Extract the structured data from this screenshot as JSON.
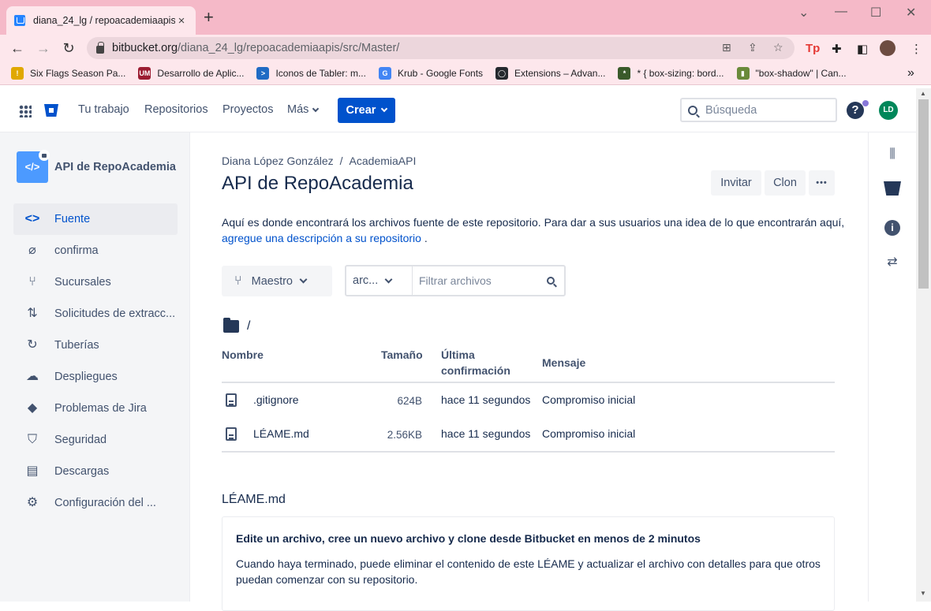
{
  "browser": {
    "tab_title": "diana_24_lg / repoacademiaapis",
    "tab_close": "×",
    "new_tab": "+",
    "url_host": "bitbucket.org",
    "url_path": "/diana_24_lg/repoacademiaapis/src/Master/",
    "bookmarks": [
      {
        "label": "Six Flags Season Pa...",
        "color": "#e0a800",
        "glyph": "!"
      },
      {
        "label": "Desarrollo de Aplic...",
        "color": "#9b1c31",
        "glyph": "UM"
      },
      {
        "label": "Iconos de Tabler: m...",
        "color": "#206bc4",
        "glyph": ">"
      },
      {
        "label": "Krub - Google Fonts",
        "color": "#4285f4",
        "glyph": "G"
      },
      {
        "label": "Extensions – Advan...",
        "color": "#24292e",
        "glyph": "◯"
      },
      {
        "label": "* { box-sizing: bord...",
        "color": "#3a5a2a",
        "glyph": "*"
      },
      {
        "label": "\"box-shadow\" | Can...",
        "color": "#6a8a3a",
        "glyph": "▮"
      }
    ],
    "bookmarks_more": "»"
  },
  "topnav": {
    "links": [
      "Tu trabajo",
      "Repositorios",
      "Proyectos",
      "Más"
    ],
    "create_label": "Crear",
    "search_placeholder": "Búsqueda",
    "help_glyph": "?",
    "avatar_initials": "LD"
  },
  "sidebar": {
    "repo_name": "API de RepoAcademia",
    "repo_avatar_glyph": "</>",
    "items": [
      {
        "label": "Fuente",
        "icon": "code-icon",
        "glyph": "<>",
        "active": true
      },
      {
        "label": "confirma",
        "icon": "commit-icon",
        "glyph": "⌀",
        "active": false
      },
      {
        "label": "Sucursales",
        "icon": "branch-icon",
        "glyph": "⑂",
        "active": false
      },
      {
        "label": "Solicitudes de extracc...",
        "icon": "pull-request-icon",
        "glyph": "⇅",
        "active": false
      },
      {
        "label": "Tuberías",
        "icon": "pipelines-icon",
        "glyph": "↻",
        "active": false
      },
      {
        "label": "Despliegues",
        "icon": "deployments-icon",
        "glyph": "☁",
        "active": false
      },
      {
        "label": "Problemas de Jira",
        "icon": "jira-icon",
        "glyph": "◆",
        "active": false
      },
      {
        "label": "Seguridad",
        "icon": "shield-icon",
        "glyph": "⛉",
        "active": false
      },
      {
        "label": "Descargas",
        "icon": "downloads-icon",
        "glyph": "▤",
        "active": false
      },
      {
        "label": "Configuración del ...",
        "icon": "gear-icon",
        "glyph": "⚙",
        "active": false
      }
    ]
  },
  "main": {
    "breadcrumb_owner": "Diana López González",
    "breadcrumb_sep": "/",
    "breadcrumb_project": "AcademiaAPI",
    "title": "API de RepoAcademia",
    "invite_label": "Invitar",
    "clone_label": "Clon",
    "more_label": "•••",
    "description_text": "Aquí es donde encontrará los archivos fuente de este repositorio. Para dar a sus usuarios una idea de lo que encontrarán aquí,",
    "description_link": "agregue una descripción a su repositorio",
    "description_end": " .",
    "branch_label": "Maestro",
    "filter_type": "arc...",
    "filter_placeholder": "Filtrar archivos",
    "path_root": "/",
    "columns": {
      "name": "Nombre",
      "size": "Tamaño",
      "last_commit_1": "Última",
      "last_commit_2": "confirmación",
      "message": "Mensaje"
    },
    "files": [
      {
        "name": ".gitignore",
        "size": "624B",
        "time": "hace 11 segundos",
        "message": "Compromiso inicial"
      },
      {
        "name": "LÉAME.md",
        "size": "2.56KB",
        "time": "hace 11 segundos",
        "message": "Compromiso inicial"
      }
    ],
    "readme_title": "LÉAME.md",
    "readme_heading": "Edite un archivo, cree un nuevo archivo y clone desde Bitbucket en menos de 2 minutos",
    "readme_paragraph": "Cuando haya terminado, puede eliminar el contenido de este LÉAME y actualizar el archivo con detalles para que otros puedan comenzar con su repositorio."
  },
  "rail": {
    "info_glyph": "i"
  }
}
